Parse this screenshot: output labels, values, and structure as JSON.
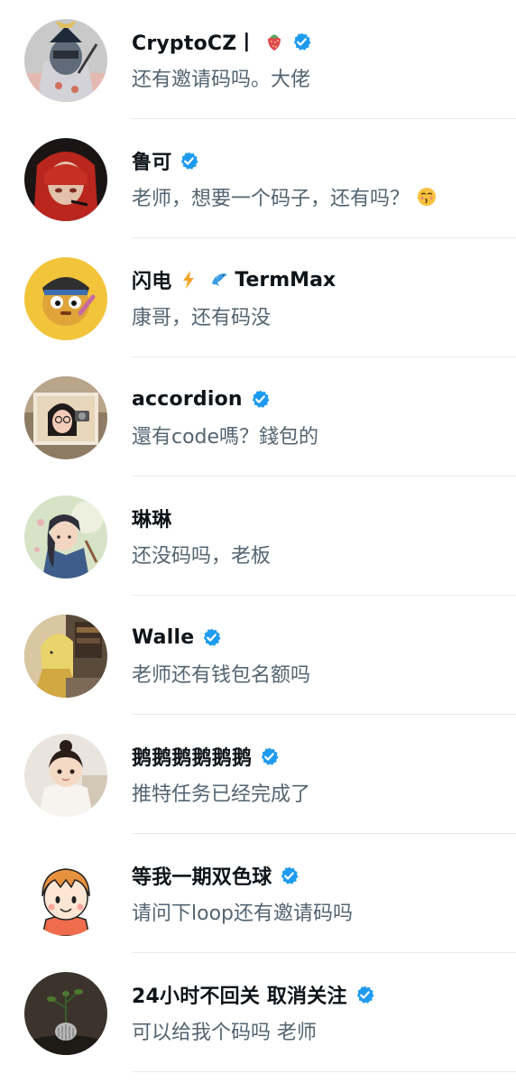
{
  "colors": {
    "name": "#0f1419",
    "message": "#536471",
    "verified": "#1d9bf0",
    "divider": "#e7eaed"
  },
  "conversations": [
    {
      "name": "CryptoCZ丨",
      "name_emoji": "strawberry-emoji",
      "verified": true,
      "message": "还有邀请码吗。大佬"
    },
    {
      "name": "鲁可",
      "verified": true,
      "message": "老师，想要一个码子，还有吗？",
      "message_emoji": "kissing-face-emoji"
    },
    {
      "name": "闪电",
      "name_emoji": "lightning-emoji",
      "name_icon": "dolphin-emoji",
      "name_extra": "TermMax",
      "verified": false,
      "message": "康哥，还有码没"
    },
    {
      "name": "accordion",
      "verified": true,
      "message": "還有code嗎？錢包的"
    },
    {
      "name": "琳琳",
      "verified": false,
      "message": "还没码吗，老板"
    },
    {
      "name": "Walle",
      "verified": true,
      "message": "老师还有钱包名额吗"
    },
    {
      "name": "鹅鹅鹅鹅鹅鹅",
      "verified": true,
      "message": "推特任务已经完成了"
    },
    {
      "name": "等我一期双色球",
      "verified": true,
      "message": "请问下loop还有邀请码吗"
    },
    {
      "name": "24小时不回关 取消关注",
      "verified": true,
      "message": "可以给我个码吗 老师"
    }
  ]
}
